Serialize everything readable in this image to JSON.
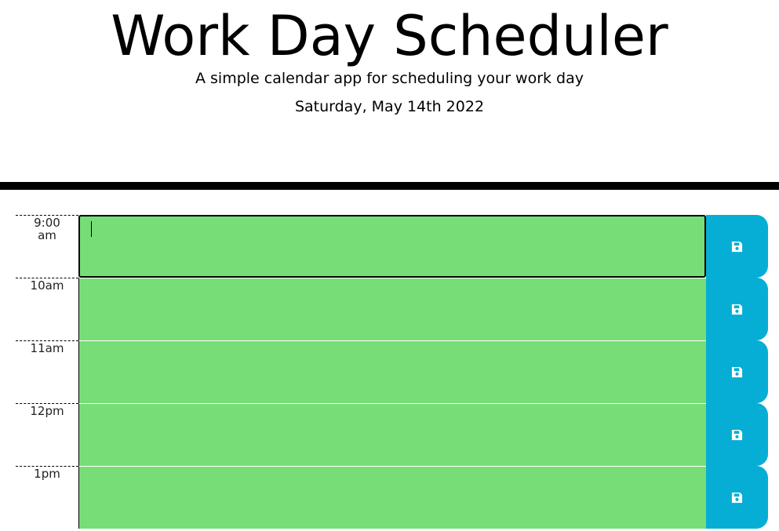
{
  "header": {
    "title": "Work Day Scheduler",
    "subtitle": "A simple calendar app for scheduling your work day",
    "current_day": "Saturday, May 14th 2022"
  },
  "timeblocks": [
    {
      "hour_line1": "9:00",
      "hour_line2": "am",
      "text": "",
      "status": "future"
    },
    {
      "hour_line1": "10am",
      "hour_line2": "",
      "text": "",
      "status": "future"
    },
    {
      "hour_line1": "11am",
      "hour_line2": "",
      "text": "",
      "status": "future"
    },
    {
      "hour_line1": "12pm",
      "hour_line2": "",
      "text": "",
      "status": "future"
    },
    {
      "hour_line1": "1pm",
      "hour_line2": "",
      "text": "",
      "status": "future"
    }
  ],
  "save_icon": "save-icon",
  "colors": {
    "future": "#77dd77",
    "save_button": "#06aed5",
    "header_border": "#000000"
  }
}
